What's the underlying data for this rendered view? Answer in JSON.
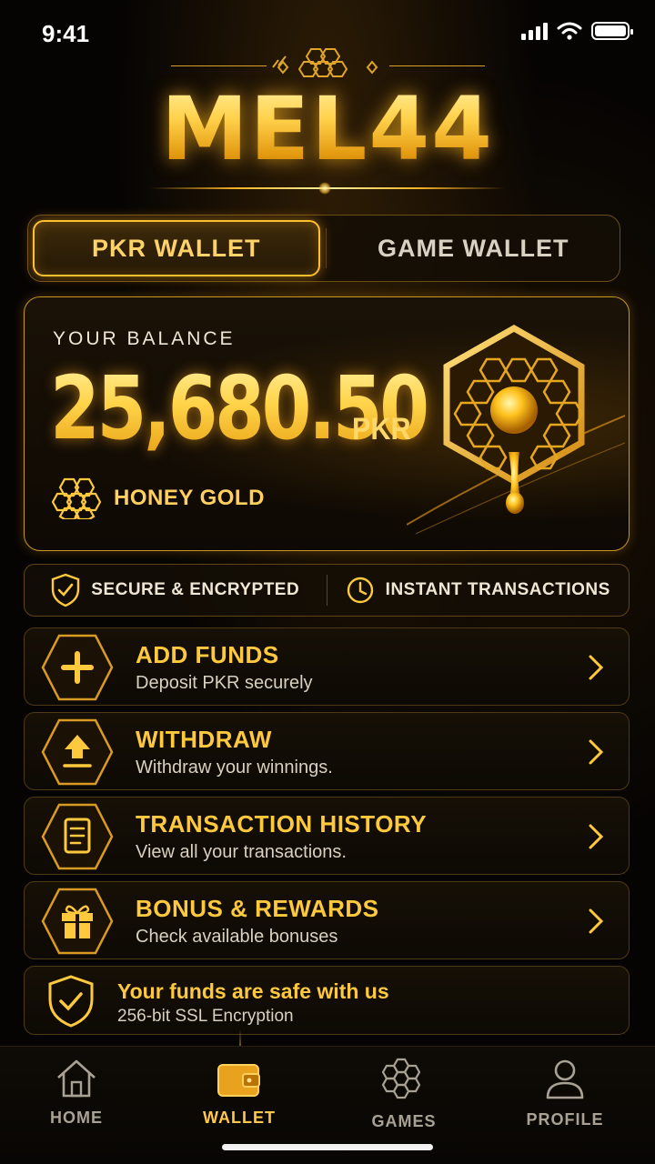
{
  "status_bar": {
    "time": "9:41"
  },
  "brand": {
    "logo_text": "MEL44"
  },
  "wallet_tabs": {
    "pkr": "PKR WALLET",
    "game": "GAME WALLET",
    "active": "pkr"
  },
  "balance": {
    "label": "YOUR BALANCE",
    "amount": "25,680.50",
    "currency": "PKR",
    "tier": "HONEY GOLD"
  },
  "features": {
    "secure": "SECURE & ENCRYPTED",
    "instant": "INSTANT TRANSACTIONS"
  },
  "actions": [
    {
      "title": "ADD FUNDS",
      "subtitle": "Deposit PKR securely",
      "icon": "plus-icon"
    },
    {
      "title": "WITHDRAW",
      "subtitle": "Withdraw your winnings.",
      "icon": "upload-icon"
    },
    {
      "title": "TRANSACTION HISTORY",
      "subtitle": "View all your transactions.",
      "icon": "document-icon"
    },
    {
      "title": "BONUS & REWARDS",
      "subtitle": "Check available bonuses",
      "icon": "gift-icon"
    }
  ],
  "safety": {
    "title": "Your funds are safe with us",
    "subtitle": "256-bit SSL Encryption"
  },
  "nav": {
    "home": "HOME",
    "wallet": "WALLET",
    "games": "GAMES",
    "profile": "PROFILE",
    "active": "wallet"
  },
  "colors": {
    "accent": "#ffc93e",
    "background": "#060403",
    "text_light": "#efe6d4"
  }
}
